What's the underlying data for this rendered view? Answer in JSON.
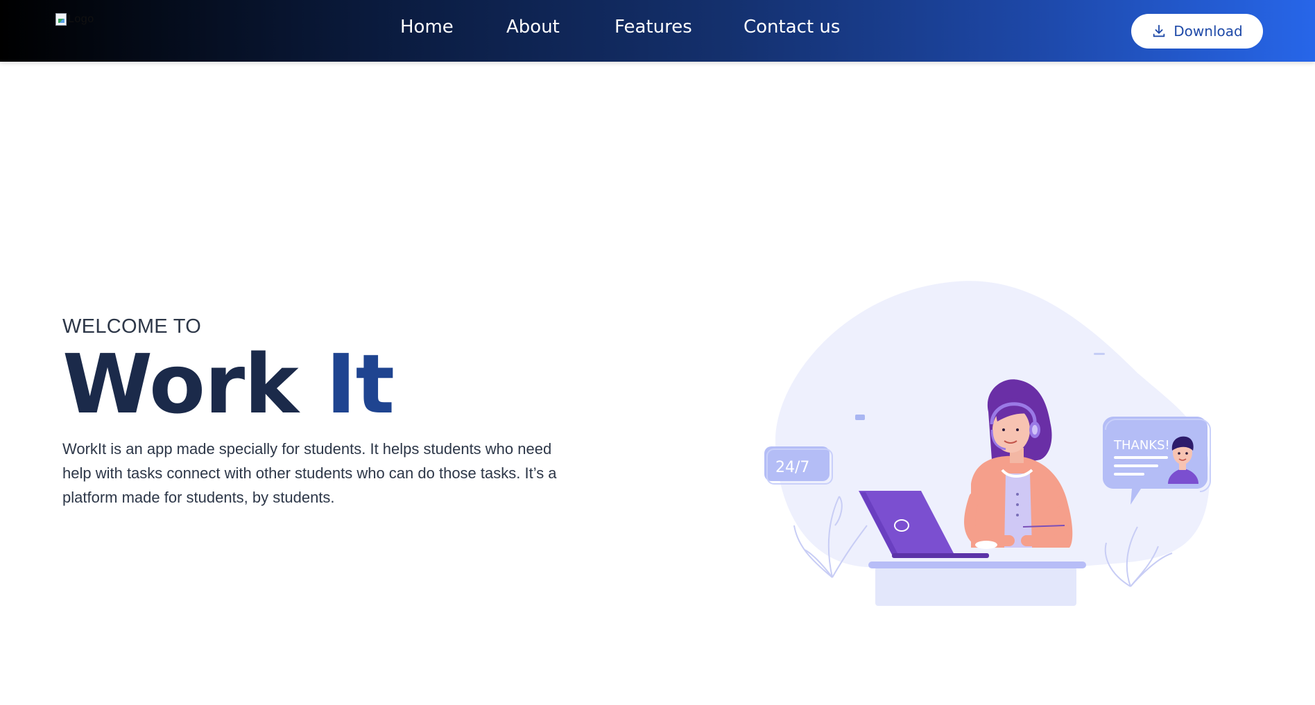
{
  "nav": {
    "logo_alt": "Logo",
    "links": [
      {
        "label": "Home"
      },
      {
        "label": "About"
      },
      {
        "label": "Features"
      },
      {
        "label": "Contact us"
      }
    ],
    "download_label": "Download"
  },
  "hero": {
    "welcome": "WELCOME TO",
    "title_part1": "Work",
    "title_part2": "It",
    "description": "WorkIt is an app made specially for students. It helps students who need help with tasks connect with other students who can do those tasks. It’s a platform made for students, by students."
  },
  "illustration": {
    "badge_text": "24/7",
    "speech_text": "THANKS!"
  },
  "colors": {
    "nav_gradient_start": "#000000",
    "nav_gradient_end": "#2766e9",
    "title_dark": "#1b2a4a",
    "title_blue": "#1f4490",
    "accent_purple": "#7b4fd0",
    "blob": "#eef0fd"
  },
  "icons": {
    "download": "download-icon",
    "logo": "broken-image-icon"
  }
}
